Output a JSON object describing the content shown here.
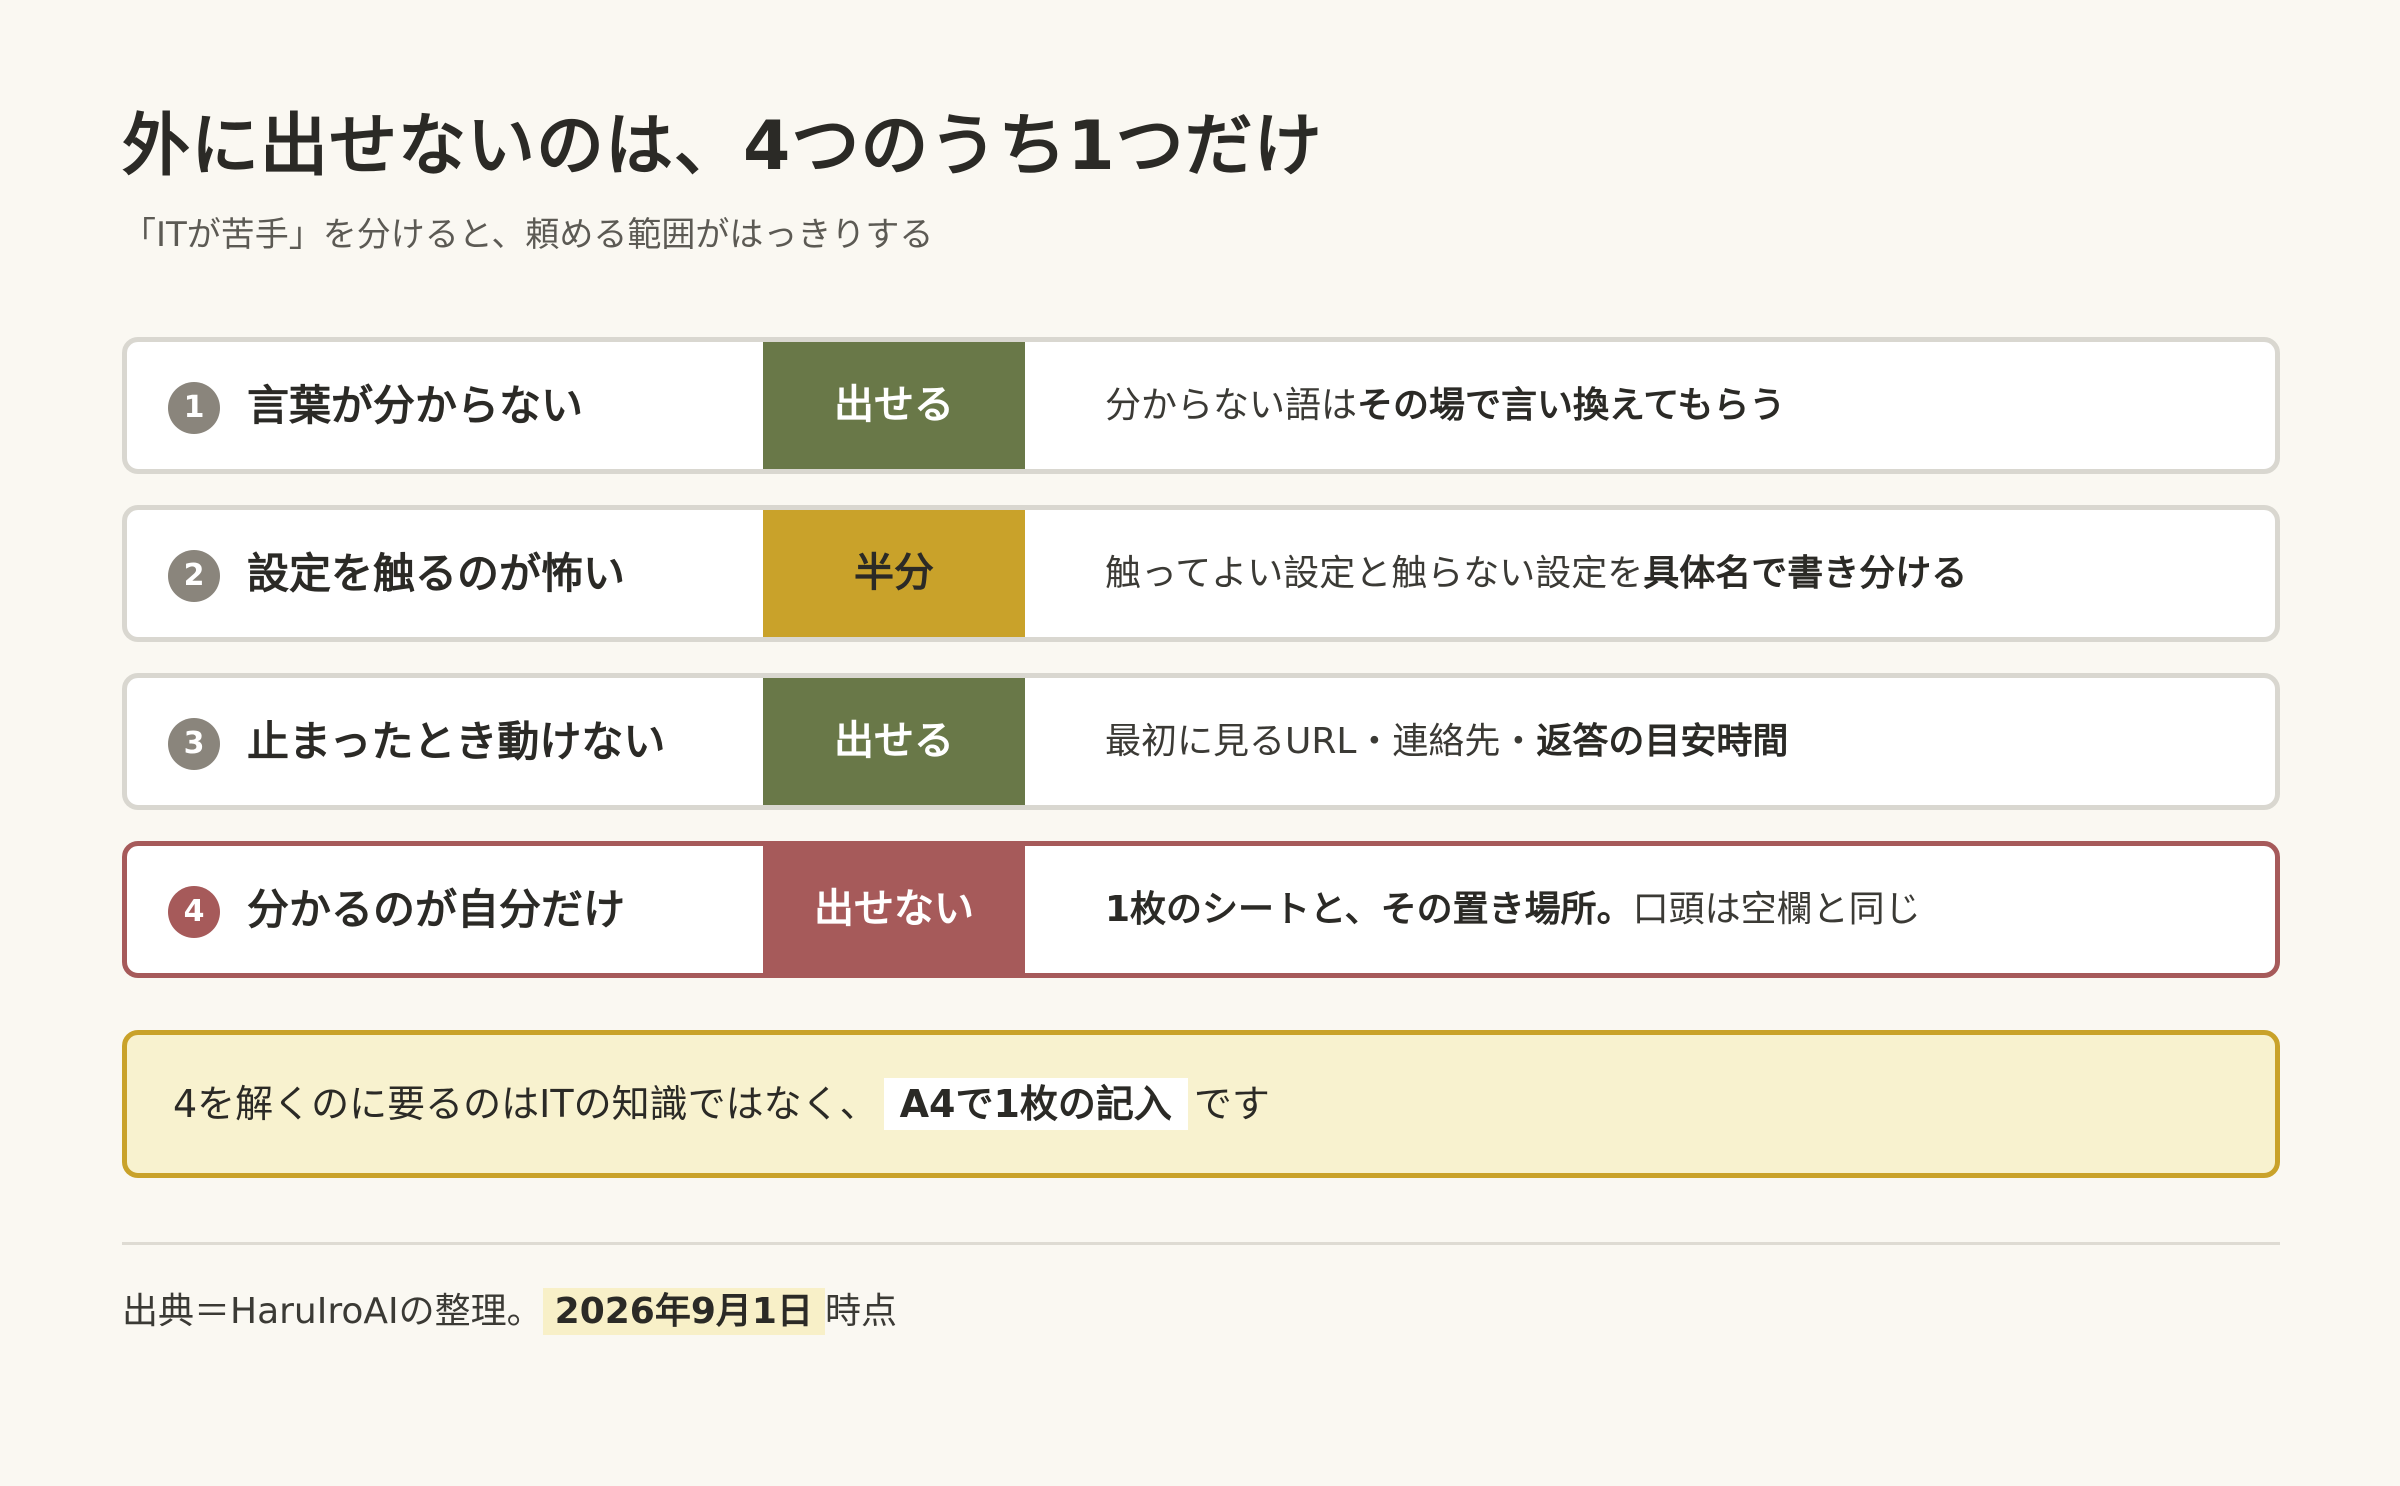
{
  "title": "外に出せないのは、4つのうち1つだけ",
  "subtitle": "「ITが苦手」を分けると、頼める範囲がはっきりする",
  "rows": [
    {
      "number": "1",
      "label": "言葉が分からない",
      "status": "出せる",
      "desc_plain": "分からない語は",
      "desc_bold": "その場で言い換えてもらう",
      "desc_tail": ""
    },
    {
      "number": "2",
      "label": "設定を触るのが怖い",
      "status": "半分",
      "desc_plain": "触ってよい設定と触らない設定を",
      "desc_bold": "具体名で書き分ける",
      "desc_tail": ""
    },
    {
      "number": "3",
      "label": "止まったとき動けない",
      "status": "出せる",
      "desc_plain": "最初に見るURL・連絡先・",
      "desc_bold": "返答の目安時間",
      "desc_tail": ""
    },
    {
      "number": "4",
      "label": "分かるのが自分だけ",
      "status": "出せない",
      "desc_plain": "",
      "desc_bold": "1枚のシートと、その置き場所。",
      "desc_tail": "口頭は空欄と同じ"
    }
  ],
  "callout": {
    "pre": "4を解くのに要るのはITの知識ではなく、",
    "highlight": "A4で1枚の記入",
    "post": "です"
  },
  "source": {
    "pre": "出典＝HaruIroAIの整理。",
    "highlight": "2026年9月1日",
    "post": "時点"
  },
  "colors": {
    "ok": "#697848",
    "half": "#c9a22a",
    "ng": "#a65a5a",
    "background": "#faf8f2",
    "callout_bg": "#f8f2cf"
  }
}
